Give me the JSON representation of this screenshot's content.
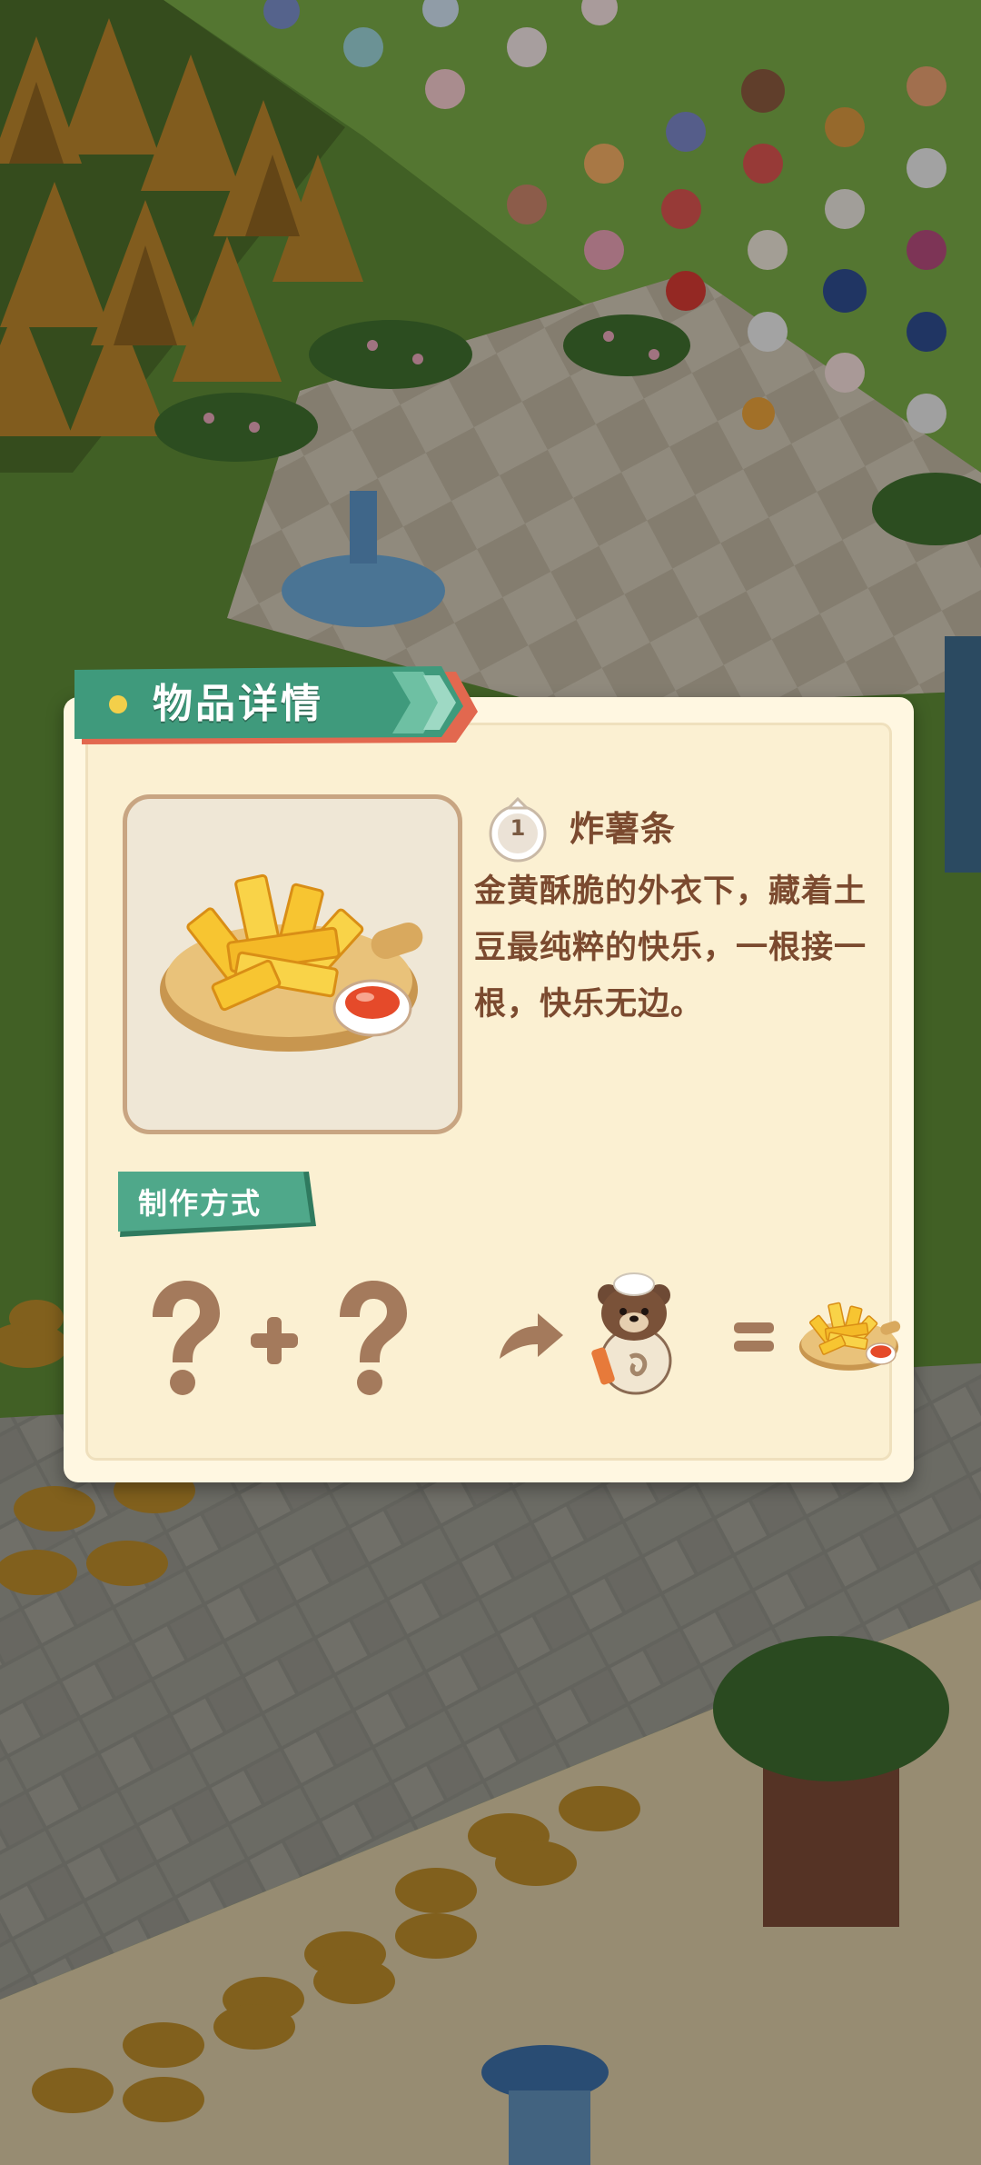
{
  "dialog": {
    "title": "物品详情",
    "item": {
      "level": "1",
      "name": "炸薯条",
      "description": "金黄酥脆的外衣下，藏着土豆最纯粹的快乐，一根接一根，快乐无边。",
      "icon": "french-fries-icon"
    },
    "craft": {
      "label": "制作方式",
      "recipe": [
        {
          "type": "ingredient",
          "icon": "unknown-question-icon"
        },
        {
          "type": "operator",
          "icon": "plus-icon"
        },
        {
          "type": "ingredient",
          "icon": "unknown-question-icon"
        },
        {
          "type": "operator",
          "icon": "arrow-icon"
        },
        {
          "type": "chef",
          "icon": "bear-chef-icon"
        },
        {
          "type": "operator",
          "icon": "equals-icon"
        },
        {
          "type": "result",
          "icon": "french-fries-icon"
        }
      ]
    }
  },
  "colors": {
    "ribbon_green": "#3f9a7c",
    "ribbon_accent": "#e2684f",
    "text_brown": "#7b4a2f",
    "panel_cream": "#fbf0d2",
    "frame_brown": "#c8a582",
    "question_brown": "#a47a5c"
  }
}
